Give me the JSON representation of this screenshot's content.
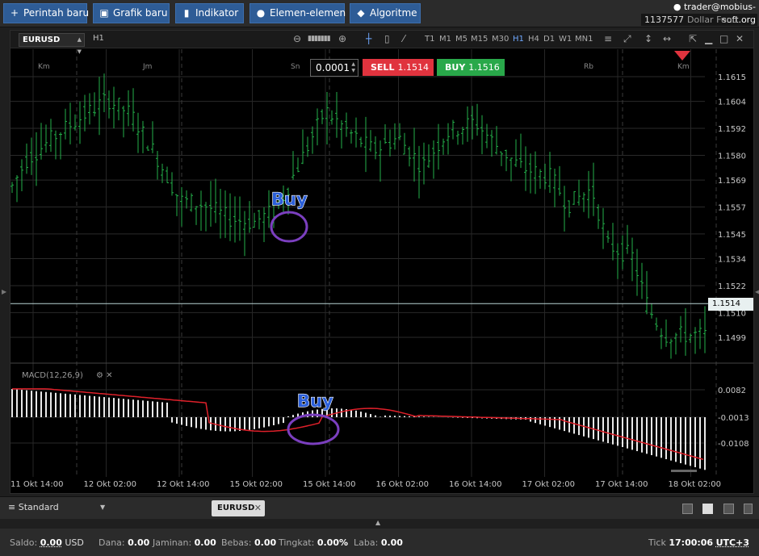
{
  "toolbar": {
    "buttons": [
      {
        "icon": "plus-icon",
        "label": "Perintah baru"
      },
      {
        "icon": "chart-icon",
        "label": "Grafik baru"
      },
      {
        "icon": "indicator-icon",
        "label": "Indikator"
      },
      {
        "icon": "elements-icon",
        "label": "Elemen-elemen"
      },
      {
        "icon": "algorithm-icon",
        "label": "Algoritme"
      }
    ]
  },
  "account": {
    "user": "trader@mobius-soft.org",
    "id": "1137577",
    "fund": "Dollar Fund"
  },
  "chart": {
    "symbol": "EURUSD",
    "timeframe": "H1",
    "timeframes": [
      "T1",
      "M1",
      "M5",
      "M15",
      "M30",
      "H1",
      "H4",
      "D1",
      "W1",
      "MN1"
    ],
    "active_timeframe": "H1",
    "quantity": "0.0001",
    "sell_label": "SELL",
    "sell_price": "1.1514",
    "buy_label": "BUY",
    "buy_price": "1.1516",
    "current_price": "1.1514",
    "macd_label": "MACD(12,26,9)",
    "annotation_buy_price": "Buy",
    "annotation_buy_macd": "Buy"
  },
  "chart_data": {
    "type": "candlestick",
    "price_axis": [
      "1.1615",
      "1.1604",
      "1.1592",
      "1.1580",
      "1.1569",
      "1.1557",
      "1.1545",
      "1.1534",
      "1.1522",
      "1.1510",
      "1.1499"
    ],
    "macd_axis": [
      "0.0082",
      "-0.0013",
      "-0.0108"
    ],
    "time_axis": [
      "11 Okt 14:00",
      "12 Okt 02:00",
      "12 Okt 14:00",
      "15 Okt 02:00",
      "15 Okt 14:00",
      "16 Okt 02:00",
      "16 Okt 14:00",
      "17 Okt 02:00",
      "17 Okt 14:00",
      "18 Okt 02:00"
    ],
    "day_labels": [
      "Km",
      "Jm",
      "Sn",
      "Rb",
      "Km"
    ],
    "ylim": [
      1.1494,
      1.1623
    ],
    "current_price": 1.1514
  },
  "bottom": {
    "workspace": "Standard",
    "tab_label": "EURUSD"
  },
  "status": {
    "saldo_label": "Saldo:",
    "saldo_value": "0.00",
    "currency": "USD",
    "dana_label": "Dana:",
    "dana_value": "0.00",
    "jaminan_label": "Jaminan:",
    "jaminan_value": "0.00",
    "bebas_label": "Bebas:",
    "bebas_value": "0.00",
    "tingkat_label": "Tingkat:",
    "tingkat_value": "0.00%",
    "laba_label": "Laba:",
    "laba_value": "0.00",
    "tick_label": "Tick",
    "time": "17:00:06",
    "timezone": "UTC+3"
  }
}
